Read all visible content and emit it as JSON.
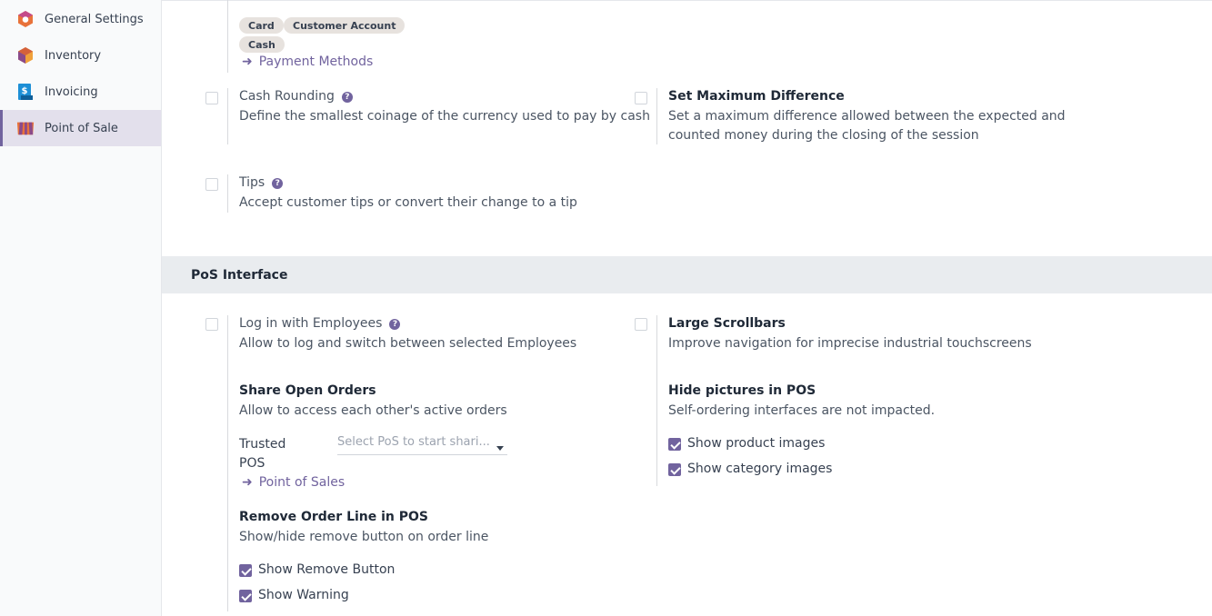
{
  "sidebar": {
    "items": [
      {
        "label": "General Settings",
        "icon": "general-settings-icon"
      },
      {
        "label": "Inventory",
        "icon": "inventory-icon"
      },
      {
        "label": "Invoicing",
        "icon": "invoicing-icon"
      },
      {
        "label": "Point of Sale",
        "icon": "point-of-sale-icon",
        "active": true
      }
    ]
  },
  "payment": {
    "tags": [
      "Card",
      "Customer Account",
      "Cash"
    ],
    "link_label": "Payment Methods"
  },
  "cash_rounding": {
    "title": "Cash Rounding",
    "desc": "Define the smallest coinage of the currency used to pay by cash",
    "checked": false
  },
  "max_difference": {
    "title": "Set Maximum Difference",
    "desc_line1": "Set a maximum difference allowed between the expected and",
    "desc_line2": "counted money during the closing of the session",
    "checked": false
  },
  "tips": {
    "title": "Tips",
    "desc": "Accept customer tips or convert their change to a tip",
    "checked": false
  },
  "section": {
    "title": "PoS Interface"
  },
  "employees": {
    "title": "Log in with Employees",
    "desc": "Allow to log and switch between selected Employees",
    "checked": false
  },
  "scrollbars": {
    "title": "Large Scrollbars",
    "desc": "Improve navigation for imprecise industrial touchscreens",
    "checked": false
  },
  "share_orders": {
    "title": "Share Open Orders",
    "desc": "Allow to access each other's active orders",
    "trusted_label_line1": "Trusted",
    "trusted_label_line2": "POS",
    "select_placeholder": "Select PoS to start shari...",
    "link_label": "Point of Sales"
  },
  "hide_pictures": {
    "title": "Hide pictures in POS",
    "desc": "Self-ordering interfaces are not impacted.",
    "options": [
      {
        "label": "Show product images",
        "checked": true
      },
      {
        "label": "Show category images",
        "checked": true
      }
    ]
  },
  "remove_line": {
    "title": "Remove Order Line in POS",
    "desc": "Show/hide remove button on order line",
    "options": [
      {
        "label": "Show Remove Button",
        "checked": true
      },
      {
        "label": "Show Warning",
        "checked": true
      }
    ]
  },
  "colors": {
    "accent": "#71639e",
    "section_bg": "#e9ecef",
    "tag_bg": "#e7e2de"
  }
}
